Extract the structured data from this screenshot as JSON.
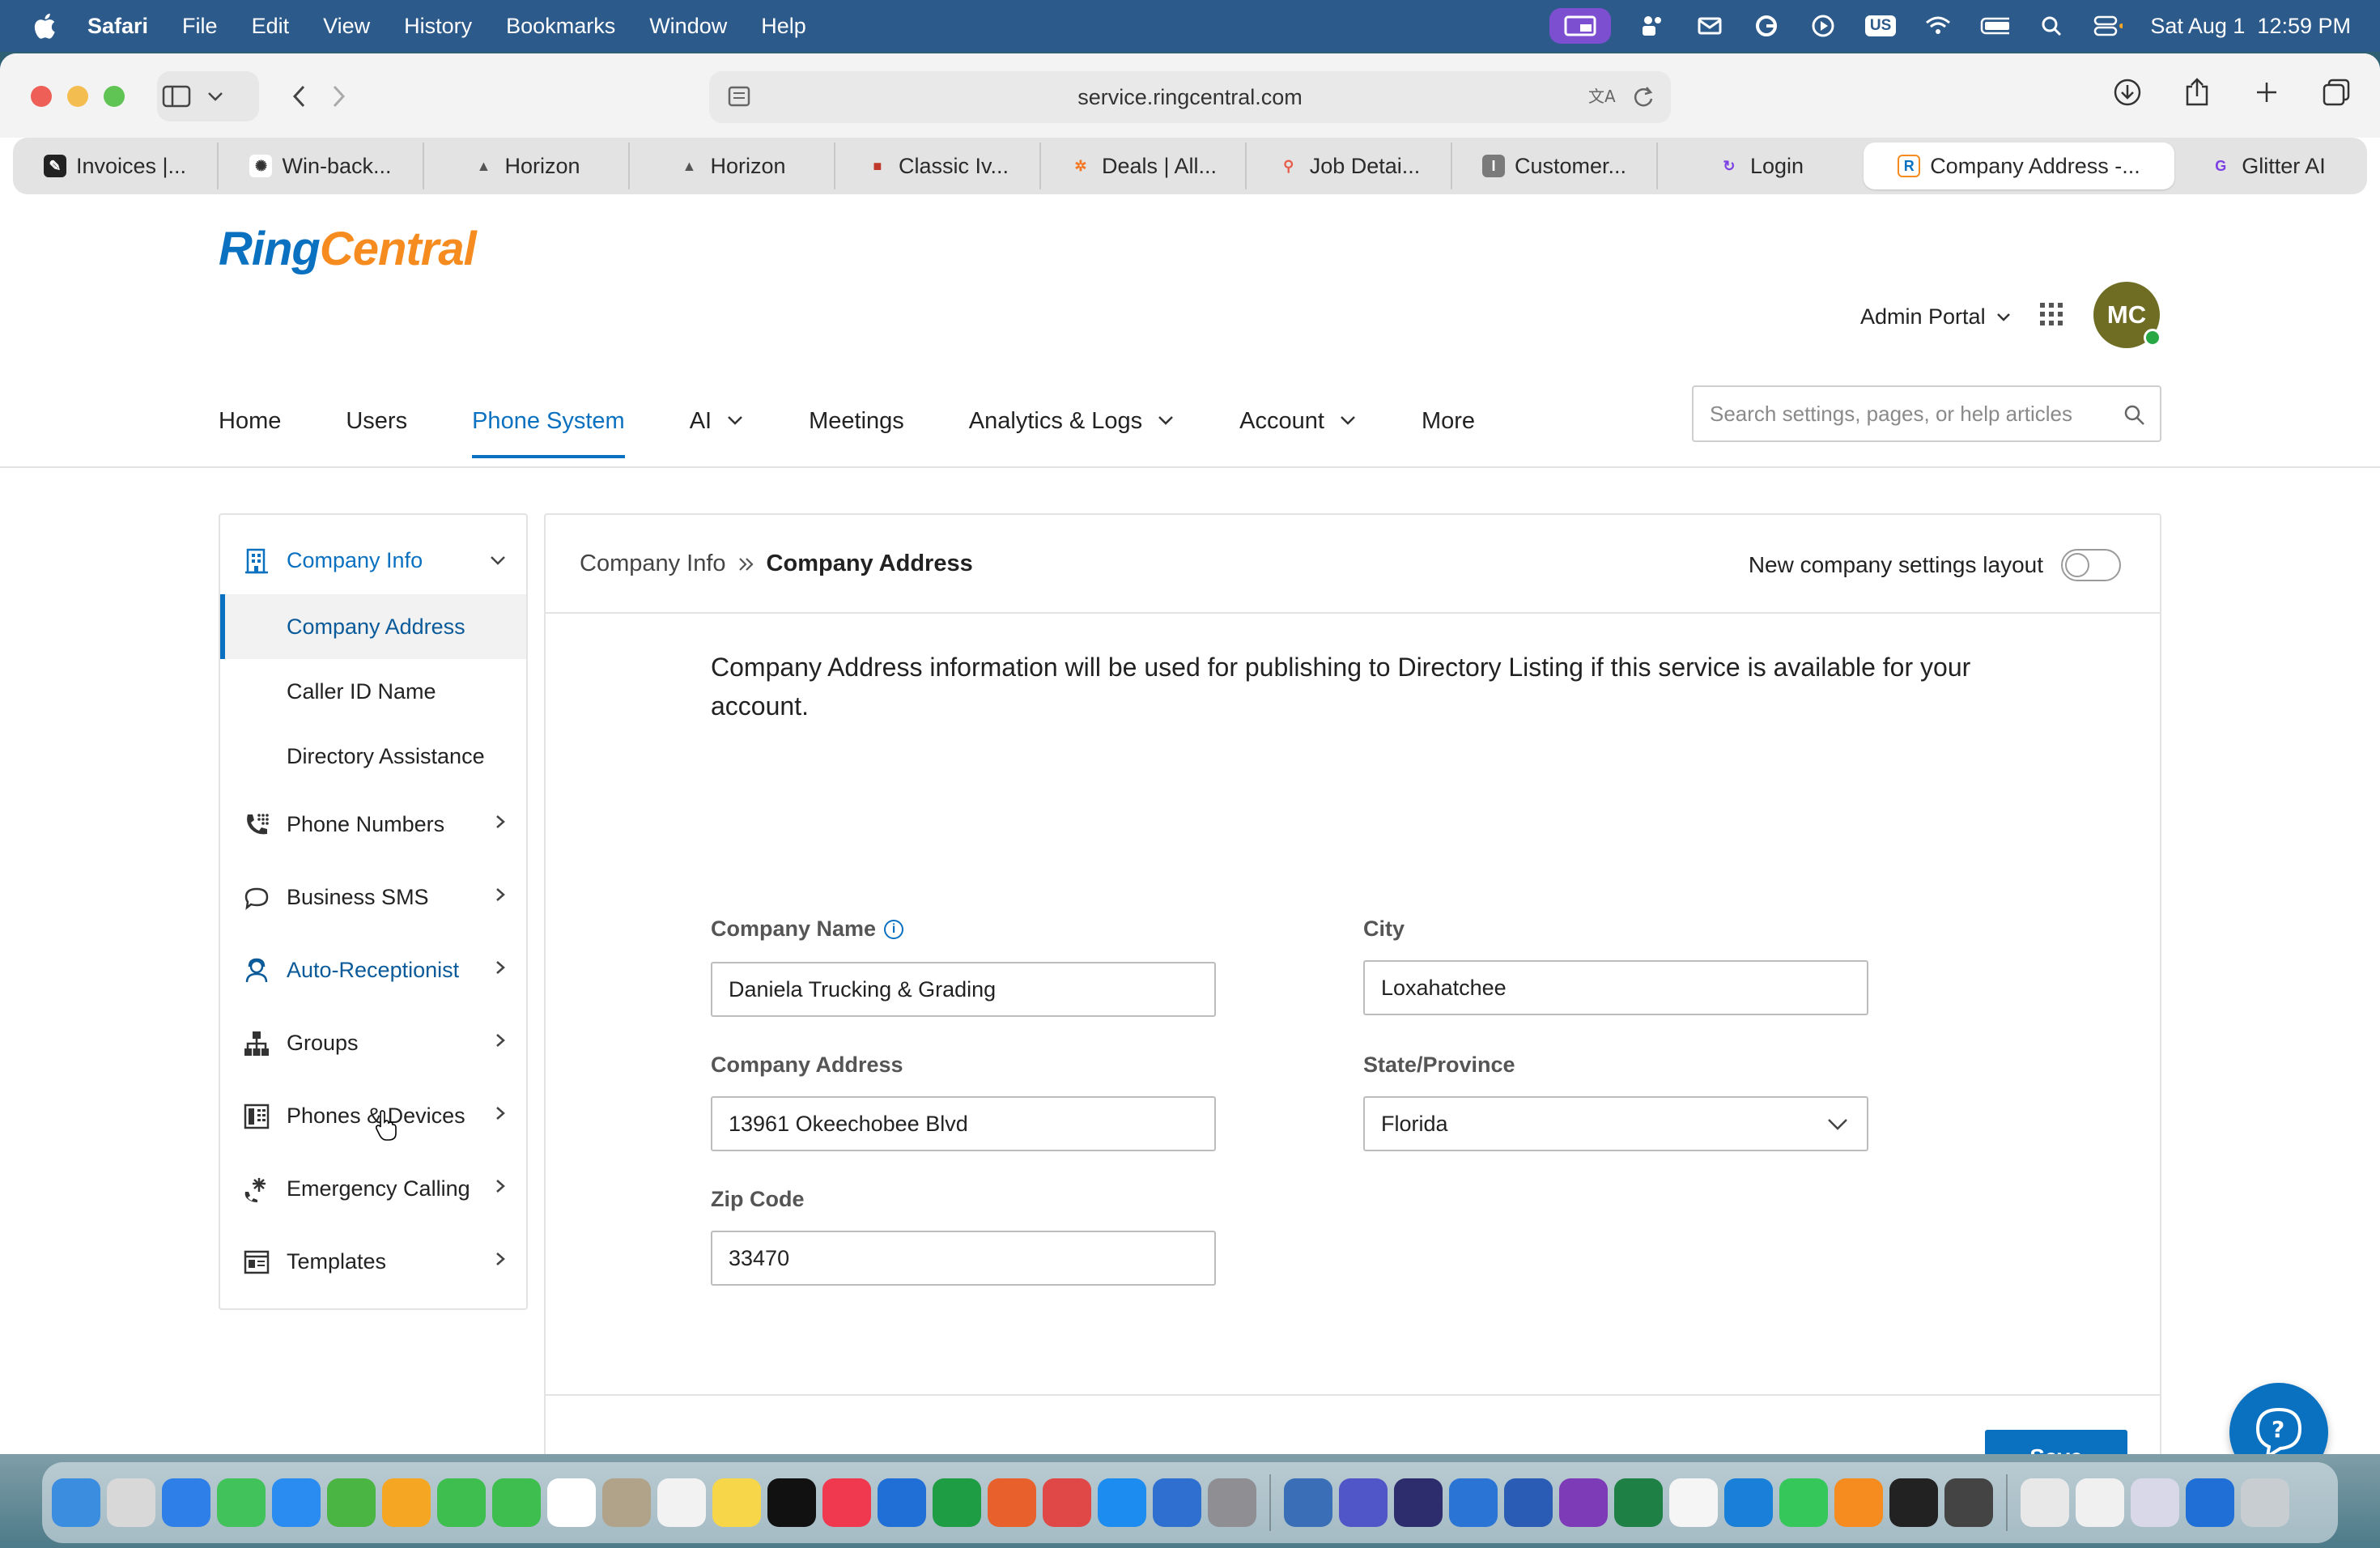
{
  "menubar": {
    "app_name": "Safari",
    "menus": [
      "File",
      "Edit",
      "View",
      "History",
      "Bookmarks",
      "Window",
      "Help"
    ],
    "input_badge": "US",
    "datetime": "Sat Aug 1  12:59 PM"
  },
  "browser": {
    "url": "service.ringcentral.com",
    "tabs": [
      {
        "label": "Invoices |...",
        "color": "#222222",
        "glyph": "✎"
      },
      {
        "label": "Win-back...",
        "color": "#444444",
        "glyph": "✺"
      },
      {
        "label": "Horizon",
        "color": "#555555",
        "glyph": "▲"
      },
      {
        "label": "Horizon",
        "color": "#555555",
        "glyph": "▲"
      },
      {
        "label": "Classic Iv...",
        "color": "#c0392b",
        "glyph": "■"
      },
      {
        "label": "Deals | All...",
        "color": "#f57722",
        "glyph": "✲"
      },
      {
        "label": "Job Detai...",
        "color": "#e85c4a",
        "glyph": "⚲"
      },
      {
        "label": "Customer...",
        "color": "#7a7a7a",
        "glyph": "I"
      },
      {
        "label": "Login",
        "color": "#7b3fe4",
        "glyph": "↻"
      },
      {
        "label": "Company Address -...",
        "color": "#f68b1f",
        "glyph": "R"
      },
      {
        "label": "Glitter AI",
        "color": "#7b3fe4",
        "glyph": "G"
      }
    ]
  },
  "header": {
    "logo_ring": "Ring",
    "logo_central": "Central",
    "portal_label": "Admin Portal",
    "avatar_initials": "MC",
    "search_placeholder": "Search settings, pages, or help articles"
  },
  "nav": {
    "home": "Home",
    "users": "Users",
    "phone_system": "Phone System",
    "ai": "AI",
    "meetings": "Meetings",
    "analytics": "Analytics & Logs",
    "account": "Account",
    "more": "More"
  },
  "sidebar": {
    "company_info": "Company Info",
    "company_address": "Company Address",
    "caller_id_name": "Caller ID Name",
    "directory_assistance": "Directory Assistance",
    "phone_numbers": "Phone Numbers",
    "business_sms": "Business SMS",
    "auto_receptionist": "Auto-Receptionist",
    "groups": "Groups",
    "phones_devices": "Phones & Devices",
    "emergency_calling": "Emergency Calling",
    "templates": "Templates"
  },
  "panel": {
    "crumb_parent": "Company Info",
    "crumb_current": "Company Address",
    "layout_toggle_label": "New company settings layout",
    "intro": "Company Address information will be used for publishing to Directory Listing if this service is available for your account.",
    "company_name_label": "Company Name",
    "company_name_value": "Daniela Trucking & Grading",
    "company_address_label": "Company Address",
    "company_address_value": "13961 Okeechobee Blvd",
    "zip_label": "Zip Code",
    "zip_value": "33470",
    "city_label": "City",
    "city_value": "Loxahatchee",
    "state_label": "State/Province",
    "state_value": "Florida",
    "save_label": "Save"
  },
  "dock": {
    "icons": [
      "finder-icon",
      "launchpad-icon",
      "safari-icon",
      "messages-icon",
      "mail-icon",
      "maps-icon",
      "photos-icon",
      "facetime-icon",
      "phone-icon",
      "calendar-icon",
      "contacts-icon",
      "reminders-icon",
      "notes-icon",
      "appletv-icon",
      "music-icon",
      "keynote-icon",
      "numbers-icon",
      "pages-icon",
      "rocket-icon",
      "appstore-icon",
      "preview-icon",
      "settings-icon",
      "sep",
      "db-icon",
      "teams-icon",
      "glitter-icon",
      "outlook-icon",
      "word-icon",
      "onenote-icon",
      "excel-icon",
      "sheet-icon",
      "quickq-icon",
      "whatsapp-icon",
      "ringcentral-icon",
      "colorui-icon",
      "calculator-icon",
      "sep",
      "doc-icon",
      "scan-icon",
      "files-icon",
      "window-icon",
      "trash-icon"
    ],
    "colors": [
      "#3b8de0",
      "#d8d8d8",
      "#2f7fe8",
      "#42c25a",
      "#2a8cf0",
      "#4bb543",
      "#f5a623",
      "#3dbe4f",
      "#3dbe4f",
      "#ffffff",
      "#b0a38a",
      "#f2f2f2",
      "#f7d64a",
      "#111111",
      "#f0384f",
      "#1f6fd6",
      "#1f9d45",
      "#e8612c",
      "#e04848",
      "#1d8cf0",
      "#2e6fd0",
      "#8e8e93",
      "sep",
      "#3a6fb8",
      "#5055c8",
      "#2d2d6e",
      "#2a74d6",
      "#2a5bb5",
      "#7e3bb8",
      "#1f8045",
      "#f5f5f5",
      "#1a7fd8",
      "#35c759",
      "#f68b1f",
      "#222222",
      "#444444",
      "sep",
      "#e8e8e8",
      "#f0f0f0",
      "#d8d8e8",
      "#1f6fd6",
      "#c8cdd2"
    ]
  }
}
